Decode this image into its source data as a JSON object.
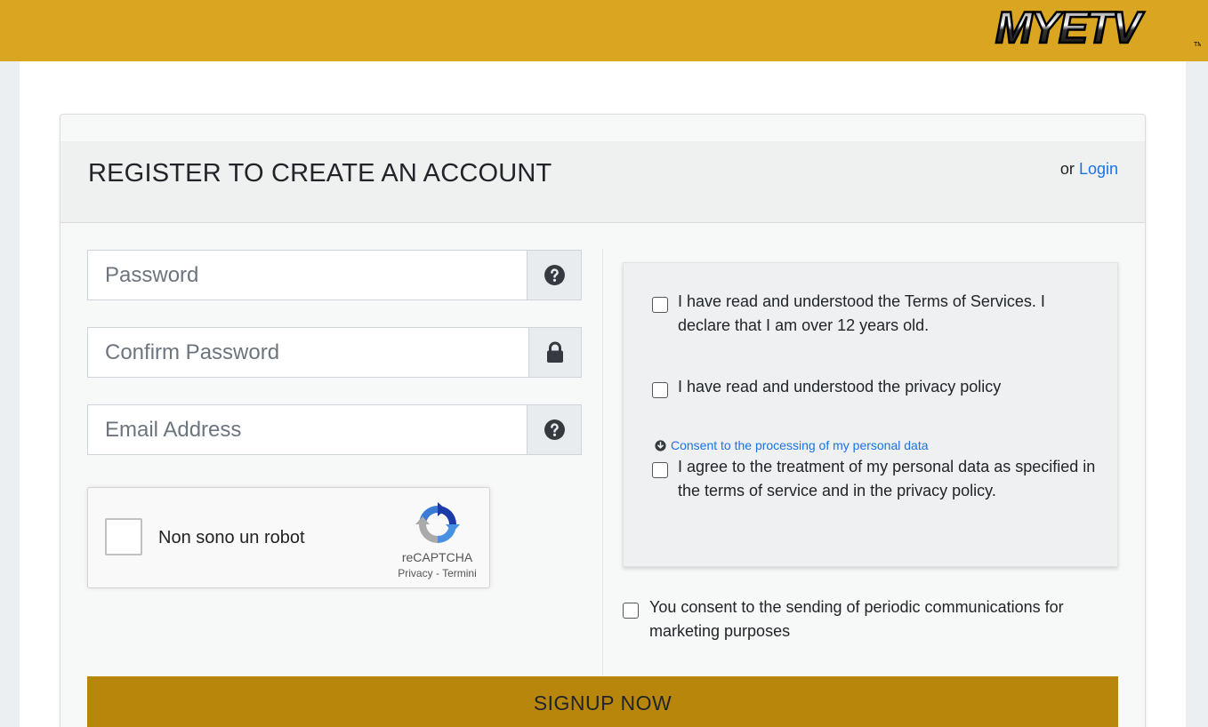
{
  "header": {
    "logo_text": "MYETV",
    "logo_tm": "TM"
  },
  "card": {
    "title": "REGISTER TO CREATE AN ACCOUNT",
    "login_prefix": "or",
    "login_link": "Login"
  },
  "form": {
    "password_placeholder": "Password",
    "confirm_password_placeholder": "Confirm Password",
    "email_placeholder": "Email Address"
  },
  "recaptcha": {
    "label": "Non sono un robot",
    "brand": "reCAPTCHA",
    "privacy": "Privacy",
    "separator": "-",
    "terms": "Termini"
  },
  "consents": {
    "terms_text": "I have read and understood the Terms of Services. I declare that I am over 12 years old.",
    "privacy_text": "I have read and understood the privacy policy",
    "processing_link": "Consent to the processing of my personal data",
    "treatment_text": "I agree to the treatment of my personal data as specified in the terms of service and in the privacy policy.",
    "marketing_text": "You consent to the sending of periodic communications for marketing purposes"
  },
  "actions": {
    "signup_label": "SIGNUP NOW"
  },
  "colors": {
    "topbar": "#daa520",
    "button": "#b8860b",
    "link": "#1a73e8"
  }
}
